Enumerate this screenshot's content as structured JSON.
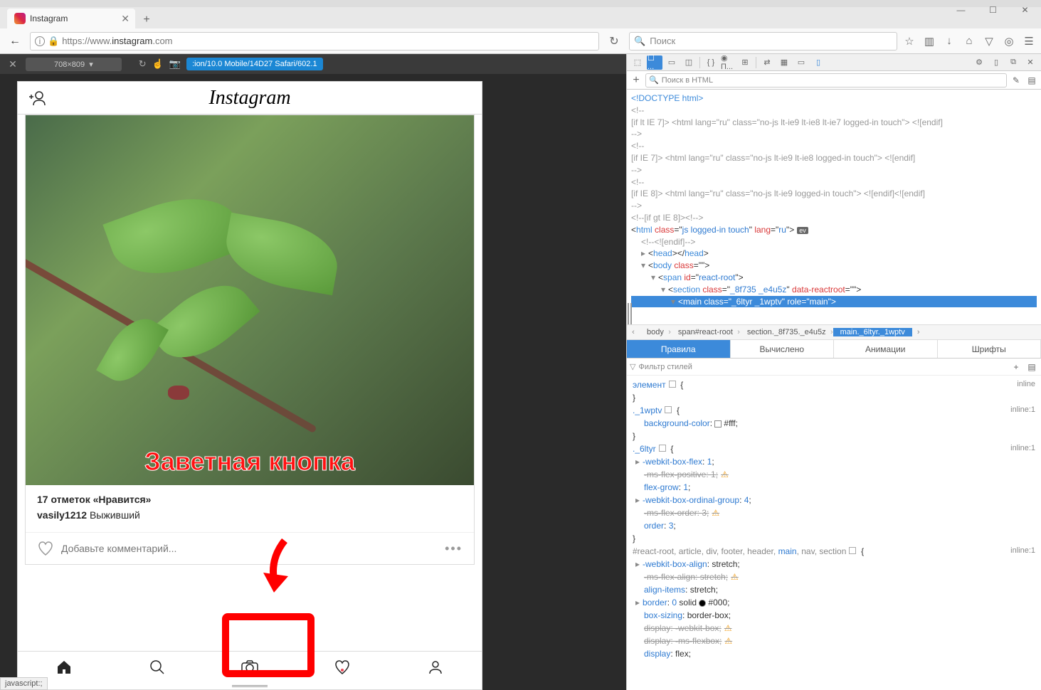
{
  "window": {
    "min": "—",
    "max": "☐",
    "close": "✕"
  },
  "tab": {
    "title": "Instagram"
  },
  "url": {
    "prefix": "https://www.",
    "domain": "instagram",
    "suffix": ".com"
  },
  "search": {
    "placeholder": "Поиск"
  },
  "toolbar_icons": [
    "star",
    "clipboard",
    "download",
    "home",
    "pocket",
    "target",
    "menu"
  ],
  "rdm": {
    "size": "708×809",
    "ua": ":ion/10.0 Mobile/14D27 Safari/602.1"
  },
  "instagram": {
    "logo": "Instagram",
    "likes": "17 отметок «Нравится»",
    "username": "vasily1212",
    "caption": "Выживший",
    "comment_placeholder": "Добавьте комментарий...",
    "annotation": "Заветная кнопка",
    "nav": [
      "home",
      "search",
      "camera",
      "heart",
      "profile"
    ]
  },
  "devtools": {
    "search_placeholder": "Поиск в HTML",
    "filter_placeholder": "Фильтр стилей",
    "html_lines": [
      {
        "i": 0,
        "c": "<!DOCTYPE html>"
      },
      {
        "i": 0,
        "c": "<!--"
      },
      {
        "i": 0,
        "c": "[if lt IE 7]> <html lang=\"ru\" class=\"no-js lt-ie9 lt-ie8 lt-ie7 logged-in touch\"> <![endif]"
      },
      {
        "i": 0,
        "c": "-->"
      },
      {
        "i": 0,
        "c": "<!--"
      },
      {
        "i": 0,
        "c": "[if IE 7]> <html lang=\"ru\" class=\"no-js lt-ie9 lt-ie8 logged-in touch\"> <![endif]"
      },
      {
        "i": 0,
        "c": "-->"
      },
      {
        "i": 0,
        "c": "<!--"
      },
      {
        "i": 0,
        "c": "[if IE 8]> <html lang=\"ru\" class=\"no-js lt-ie9 logged-in touch\"> <![endif]<![endif]"
      },
      {
        "i": 0,
        "c": "-->"
      },
      {
        "i": 0,
        "c": "<!--[if gt IE 8]><!-->"
      }
    ],
    "html_open": "<html class=\"js logged-in touch\" lang=\"ru\">",
    "endif": "<!--<![endif]-->",
    "head": "<head></head>",
    "body_open": "<body class=\"\">",
    "span_root": "<span id=\"react-root\">",
    "section": "<section class=\"_8f735 _e4u5z\" data-reactroot=\"\">",
    "main_sel": "<main class=\"_6ltyr _1wptv\" role=\"main\">",
    "breadcrumb": [
      "body",
      "span#react-root",
      "section._8f735._e4u5z",
      "main._6ltyr._1wptv"
    ],
    "subtabs": [
      "Правила",
      "Вычислено",
      "Анимации",
      "Шрифты"
    ],
    "styles": {
      "element": "элемент",
      "inline": "inline",
      "rule1": {
        "sel": "._1wptv",
        "src": "inline:1",
        "props": [
          {
            "n": "background-color",
            "v": "#fff",
            "swatch": "white"
          }
        ]
      },
      "rule2": {
        "sel": "._6ltyr",
        "src": "inline:1",
        "props": [
          {
            "n": "-webkit-box-flex",
            "v": "1",
            "tri": true
          },
          {
            "n": "-ms-flex-positive",
            "v": "1",
            "strike": true,
            "warn": true
          },
          {
            "n": "flex-grow",
            "v": "1"
          },
          {
            "n": "-webkit-box-ordinal-group",
            "v": "4",
            "tri": true
          },
          {
            "n": "-ms-flex-order",
            "v": "3",
            "strike": true,
            "warn": true
          },
          {
            "n": "order",
            "v": "3"
          }
        ]
      },
      "rule3": {
        "sel": "#react-root, article, div, footer, header, main, nav, section",
        "src": "inline:1",
        "props": [
          {
            "n": "-webkit-box-align",
            "v": "stretch",
            "tri": true
          },
          {
            "n": "-ms-flex-align",
            "v": "stretch",
            "strike": true,
            "warn": true
          },
          {
            "n": "align-items",
            "v": "stretch"
          },
          {
            "n": "border",
            "v": "0 solid #000",
            "tri": true,
            "swatch": "black"
          },
          {
            "n": "box-sizing",
            "v": "border-box"
          },
          {
            "n": "display",
            "v": "-webkit-box",
            "strike": true,
            "warn": true
          },
          {
            "n": "display",
            "v": "-ms-flexbox",
            "strike": true,
            "warn": true
          },
          {
            "n": "display",
            "v": "flex"
          }
        ]
      }
    }
  },
  "status": "javascript:;"
}
